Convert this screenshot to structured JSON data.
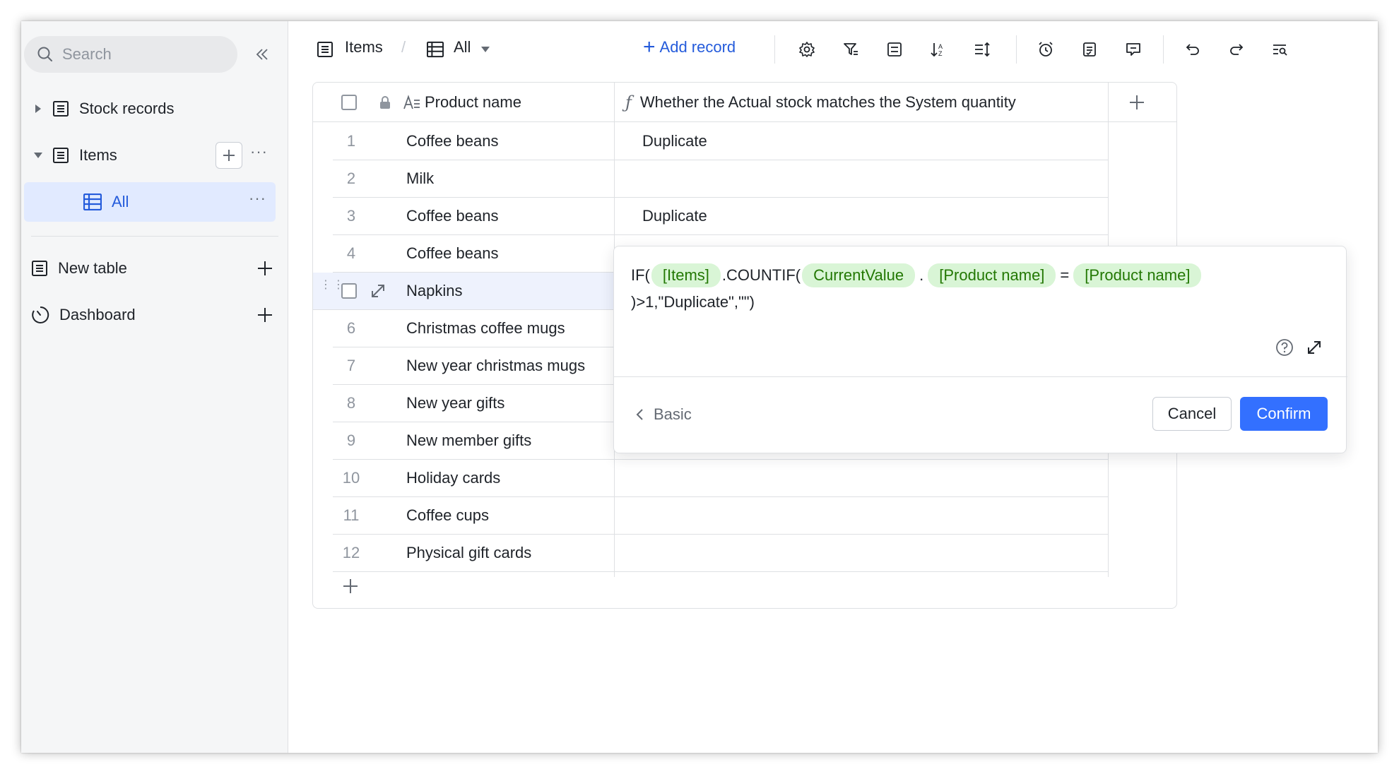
{
  "sidebar": {
    "search_placeholder": "Search",
    "items": [
      {
        "label": "Stock records"
      },
      {
        "label": "Items"
      },
      {
        "label": "All"
      }
    ],
    "new_table": "New table",
    "dashboard": "Dashboard"
  },
  "toolbar": {
    "table_name": "Items",
    "breadcrumb_separator": "/",
    "view_name": "All",
    "add_record": "Add record"
  },
  "table": {
    "columns": [
      {
        "label": "Product name"
      },
      {
        "label": "Whether the Actual stock matches the System quantity"
      }
    ],
    "rows": [
      {
        "num": "1",
        "name": "Coffee beans",
        "value": "Duplicate"
      },
      {
        "num": "2",
        "name": "Milk",
        "value": ""
      },
      {
        "num": "3",
        "name": "Coffee beans",
        "value": "Duplicate"
      },
      {
        "num": "4",
        "name": "Coffee beans",
        "value": ""
      },
      {
        "num": "5",
        "name": "Napkins",
        "value": ""
      },
      {
        "num": "6",
        "name": "Christmas coffee mugs",
        "value": ""
      },
      {
        "num": "7",
        "name": "New year christmas mugs",
        "value": ""
      },
      {
        "num": "8",
        "name": "New year gifts",
        "value": ""
      },
      {
        "num": "9",
        "name": "New member gifts",
        "value": ""
      },
      {
        "num": "10",
        "name": "Holiday cards",
        "value": ""
      },
      {
        "num": "11",
        "name": "Coffee cups",
        "value": ""
      },
      {
        "num": "12",
        "name": "Physical gift cards",
        "value": ""
      }
    ]
  },
  "formula": {
    "prefix": "IF(",
    "token_items": "[Items]",
    "countif": ".COUNTIF(",
    "token_current": "CurrentValue",
    "dot": ".",
    "token_field1": "[Product name]",
    "equals": "=",
    "token_field2": "[Product name]",
    "suffix": ")>1,\"Duplicate\",\"\")"
  },
  "popup": {
    "basic": "Basic",
    "cancel": "Cancel",
    "confirm": "Confirm"
  }
}
